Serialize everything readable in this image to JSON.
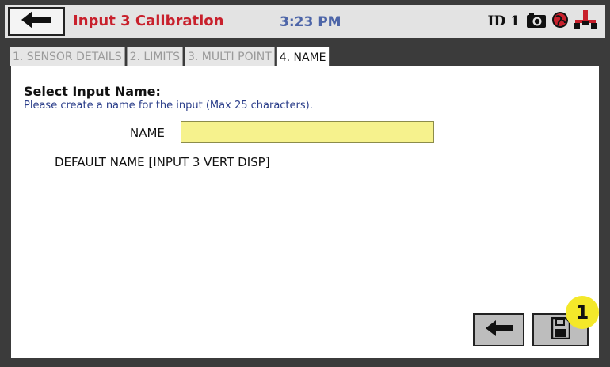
{
  "header": {
    "title": "Input 3 Calibration",
    "time": "3:23 PM",
    "id_label": "ID 1",
    "icons": [
      "back-arrow-icon",
      "camera-icon",
      "globe-icon",
      "network-icon"
    ]
  },
  "tabs": [
    {
      "label": "1. SENSOR DETAILS",
      "active": false
    },
    {
      "label": "2. LIMITS",
      "active": false
    },
    {
      "label": "3. MULTI POINT",
      "active": false
    },
    {
      "label": "4. NAME",
      "active": true
    }
  ],
  "form": {
    "heading": "Select Input Name:",
    "instruction": "Please create a name for the input (Max 25 characters).",
    "name_label": "NAME",
    "name_value": "",
    "default_name": "DEFAULT NAME [INPUT 3 VERT DISP]"
  },
  "footer": {
    "back_icon": "back-arrow-icon",
    "save_icon": "save-icon",
    "callout": "1"
  },
  "colors": {
    "title": "#c8202c",
    "clock": "#4d65a8",
    "instruction": "#2b3e8a",
    "input_bg": "#f6f28d",
    "callout": "#f4e82a"
  }
}
